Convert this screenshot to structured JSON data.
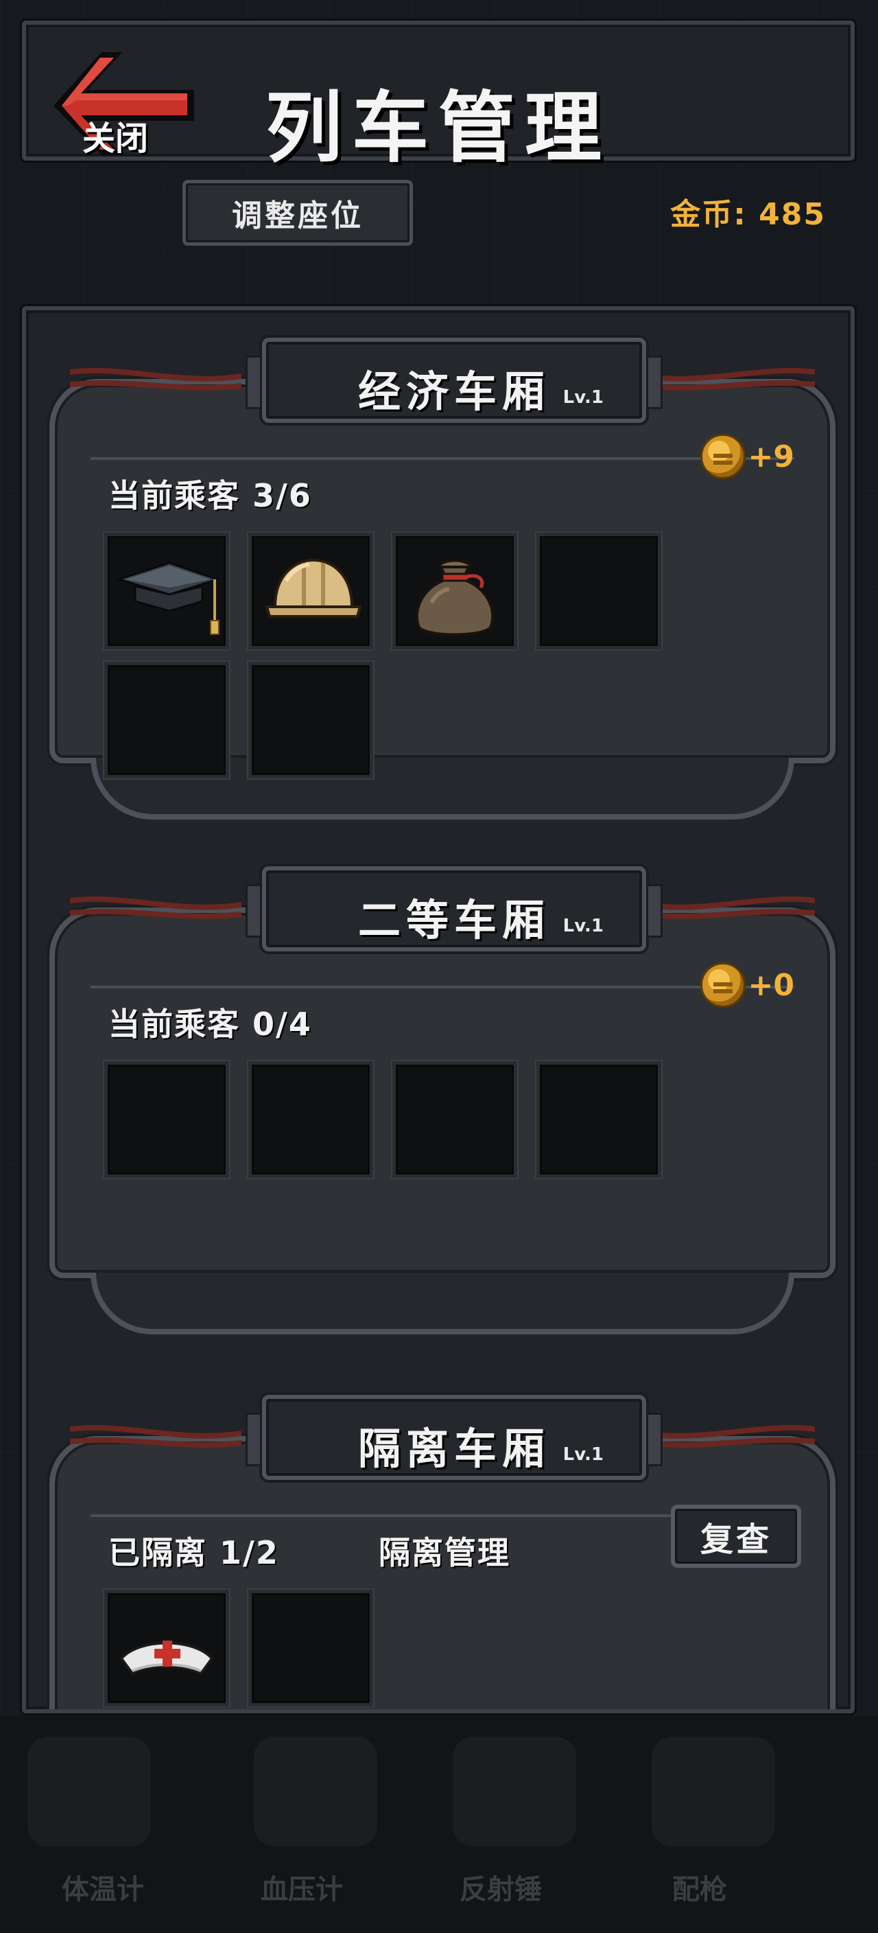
{
  "header": {
    "close_label": "关闭",
    "title": "列车管理"
  },
  "toolbar": {
    "adjust_seats_label": "调整座位",
    "gold_text": "金币: 485"
  },
  "cars": [
    {
      "name": "经济车厢",
      "level": "Lv.1",
      "income": "+9",
      "passenger_text": "当前乘客 3/6",
      "slots": [
        "graduation-cap-icon",
        "hard-hat-icon",
        "money-sack-icon",
        "empty",
        "empty",
        "empty"
      ]
    },
    {
      "name": "二等车厢",
      "level": "Lv.1",
      "income": "+0",
      "passenger_text": "当前乘客 0/4",
      "slots": [
        "empty",
        "empty",
        "empty",
        "empty"
      ]
    },
    {
      "name": "隔离车厢",
      "level": "Lv.1",
      "quarantine_text": "已隔离 1/2",
      "manage_label": "隔离管理",
      "recheck_label": "复查",
      "slots": [
        "nurse-cap-icon",
        "empty"
      ]
    }
  ],
  "bottom_tools": [
    "体温计",
    "血压计",
    "反射锤",
    "配枪"
  ],
  "colors": {
    "gold": "#f2b23a",
    "panel": "#202328",
    "frame": "#3c4047",
    "accent_red": "#c8322b"
  }
}
